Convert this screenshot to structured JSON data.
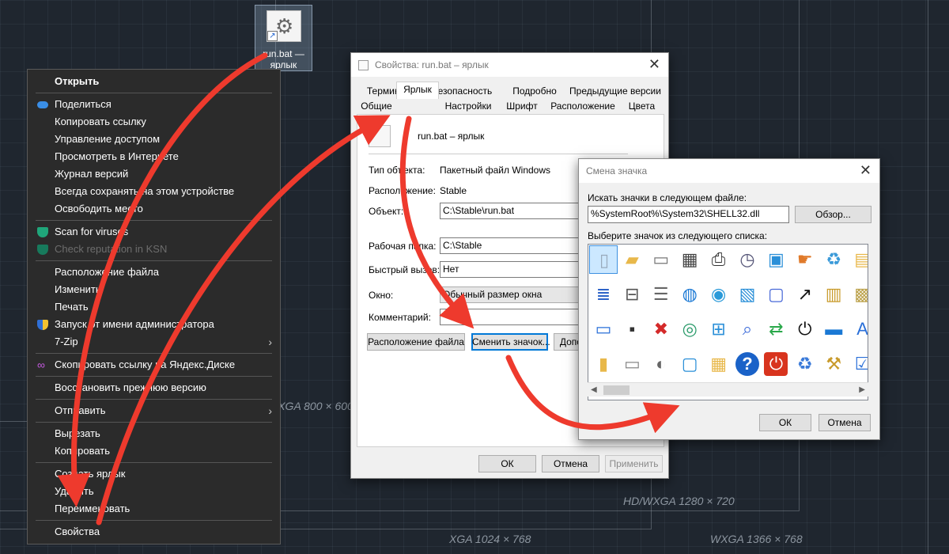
{
  "desktop": {
    "icon_label": "run.bat — ярлык",
    "resolution_labels": [
      "WXGA 800 × 600",
      "HD/WXGA 1280 × 720",
      "XGA 1024 × 768",
      "WXGA 1366 × 768"
    ]
  },
  "context_menu": {
    "items": [
      {
        "label": "Открыть"
      },
      {
        "label": "Поделиться"
      },
      {
        "label": "Копировать ссылку"
      },
      {
        "label": "Управление доступом"
      },
      {
        "label": "Просмотреть в Интернете"
      },
      {
        "label": "Журнал версий"
      },
      {
        "label": "Всегда сохранять на этом устройстве"
      },
      {
        "label": "Освободить место"
      },
      {
        "label": "Scan for viruses"
      },
      {
        "label": "Check reputation in KSN"
      },
      {
        "label": "Расположение файла"
      },
      {
        "label": "Изменить"
      },
      {
        "label": "Печать"
      },
      {
        "label": "Запуск от имени администратора"
      },
      {
        "label": "7-Zip"
      },
      {
        "label": "Скопировать ссылку на Яндекс.Диске"
      },
      {
        "label": "Восстановить прежнюю версию"
      },
      {
        "label": "Отправить"
      },
      {
        "label": "Вырезать"
      },
      {
        "label": "Копировать"
      },
      {
        "label": "Создать ярлык"
      },
      {
        "label": "Удалить"
      },
      {
        "label": "Переименовать"
      },
      {
        "label": "Свойства"
      }
    ]
  },
  "properties": {
    "title": "Свойства: run.bat – ярлык",
    "tabs_top": [
      "Терминал",
      "Безопасность",
      "Подробно",
      "Предыдущие версии"
    ],
    "tabs_bottom": [
      "Общие",
      "Ярлык",
      "Настройки",
      "Шрифт",
      "Расположение",
      "Цвета"
    ],
    "name": "run.bat – ярлык",
    "type_label": "Тип объекта:",
    "type_value": "Пакетный файл Windows",
    "location_label": "Расположение:",
    "location_value": "Stable",
    "target_label": "Объект:",
    "target_value": "C:\\Stable\\run.bat",
    "workdir_label": "Рабочая папка:",
    "workdir_value": "C:\\Stable",
    "hotkey_label": "Быстрый вызов:",
    "hotkey_value": "Нет",
    "window_label": "Окно:",
    "window_value": "Обычный размер окна",
    "comment_label": "Комментарий:",
    "comment_value": "",
    "btn_location": "Расположение файла",
    "btn_change_icon": "Сменить значок...",
    "btn_advanced": "Дополнительно...",
    "ok": "ОК",
    "cancel": "Отмена",
    "apply": "Применить"
  },
  "change_icon": {
    "title": "Смена значка",
    "search_label": "Искать значки в следующем файле:",
    "file_path": "%SystemRoot%\\System32\\SHELL32.dll",
    "browse": "Обзор...",
    "list_label": "Выберите значок из следующего списка:",
    "icons": [
      "blank-file-icon",
      "folder-icon",
      "drive-icon",
      "chip-icon",
      "printer-icon",
      "file-clock-icon",
      "monitor-icon",
      "hand-icon",
      "recycle-bin-icon",
      "folder-docs-icon",
      "document-icon",
      "network-drive-icon",
      "server-icon",
      "globe-icon",
      "network-globe-icon",
      "control-panel-icon",
      "run-icon",
      "shortcut-arrow-icon",
      "briefcase-folder-icon",
      "floppy-drive-icon",
      "window-icon",
      "floppy-icon",
      "drive-x-icon",
      "mouse-globe-icon",
      "network-icon",
      "magnifier-icon",
      "usb-icon",
      "power-icon",
      "desktop-icon",
      "fonts-folder-icon",
      "folder-half-icon",
      "disk-drive-icon",
      "cd-drive-icon",
      "computer-icon",
      "grid-folder-icon",
      "help-icon",
      "shutdown-icon",
      "recycle-full-icon",
      "tools-folder-icon",
      "checklist-icon"
    ],
    "ok": "ОК",
    "cancel": "Отмена"
  }
}
